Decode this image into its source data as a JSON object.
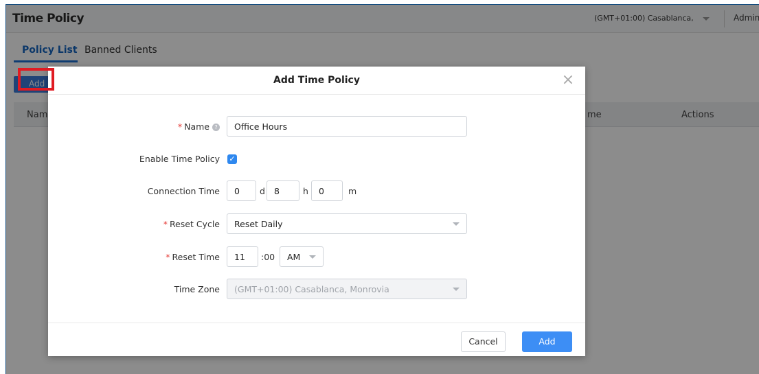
{
  "header": {
    "title": "Time Policy",
    "timezone_select": "(GMT+01:00) Casablanca,",
    "user": "Admin"
  },
  "tabs": [
    {
      "label": "Policy List",
      "active": true
    },
    {
      "label": "Banned Clients",
      "active": false
    }
  ],
  "toolbar": {
    "add_label": "Add"
  },
  "table": {
    "columns": [
      "Name",
      "me",
      "Actions"
    ]
  },
  "modal": {
    "title": "Add Time Policy",
    "fields": {
      "name": {
        "label": "Name",
        "required": true,
        "value": "Office Hours"
      },
      "enable": {
        "label": "Enable Time Policy",
        "checked": true
      },
      "connection_time": {
        "label": "Connection Time",
        "days": "0",
        "days_unit": "d",
        "hours": "8",
        "hours_unit": "h",
        "minutes": "0",
        "minutes_unit": "m"
      },
      "reset_cycle": {
        "label": "Reset Cycle",
        "required": true,
        "value": "Reset Daily"
      },
      "reset_time": {
        "label": "Reset Time",
        "required": true,
        "hour": "11",
        "minutes": ":00",
        "ampm": "AM"
      },
      "time_zone": {
        "label": "Time Zone",
        "value": "(GMT+01:00) Casablanca, Monrovia",
        "disabled": true
      }
    },
    "buttons": {
      "cancel": "Cancel",
      "add": "Add"
    }
  },
  "colors": {
    "primary": "#3d8ef5",
    "required": "#e53935",
    "highlight": "#e01b22",
    "active_tab": "#1565c0"
  }
}
